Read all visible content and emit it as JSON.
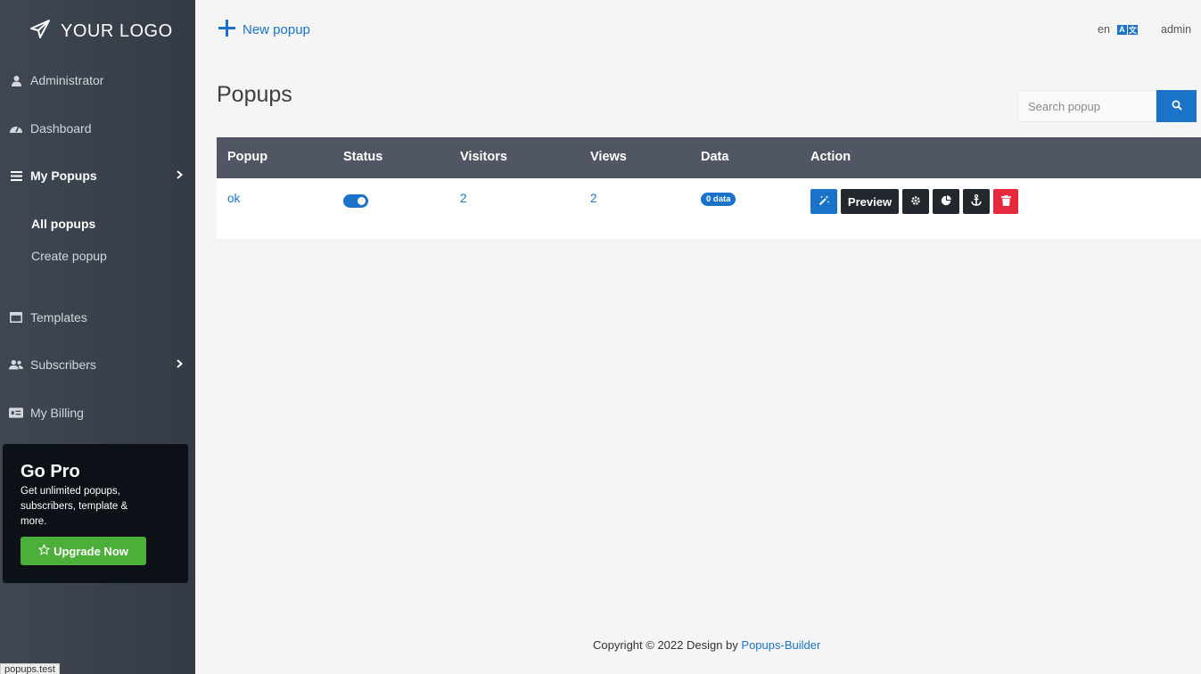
{
  "sidebar": {
    "logo_text": "YOUR LOGO",
    "items": [
      {
        "label": "Administrator",
        "icon": "user-secret-icon"
      },
      {
        "label": "Dashboard",
        "icon": "gauge-icon"
      },
      {
        "label": "My Popups",
        "icon": "list-icon"
      },
      {
        "label": "Templates",
        "icon": "window-icon"
      },
      {
        "label": "Subscribers",
        "icon": "users-icon"
      },
      {
        "label": "My Billing",
        "icon": "billing-icon"
      }
    ],
    "subitems": [
      {
        "label": "All popups"
      },
      {
        "label": "Create popup"
      }
    ],
    "gopro": {
      "title": "Go Pro",
      "text": "Get unlimited popups, subscribers, template & more.",
      "button": "Upgrade Now"
    }
  },
  "status_tooltip": "popups.test",
  "header": {
    "new_popup": "New popup",
    "lang": "en",
    "user": "admin"
  },
  "main": {
    "title": "Popups",
    "search_placeholder": "Search popup",
    "table": {
      "columns": [
        "Popup",
        "Status",
        "Visitors",
        "Views",
        "Data",
        "Action"
      ],
      "rows": [
        {
          "popup": "ok",
          "status": "on",
          "visitors": "2",
          "views": "2",
          "data": "0 data",
          "preview_label": "Preview"
        }
      ]
    }
  },
  "footer": {
    "text": "Copyright © 2022 Design by ",
    "link": "Popups-Builder"
  },
  "colors": {
    "accent": "#1a73c9",
    "sidebar_bg": "#3f4752",
    "table_header": "#505663",
    "danger": "#e6293c",
    "success": "#4caf3a"
  }
}
